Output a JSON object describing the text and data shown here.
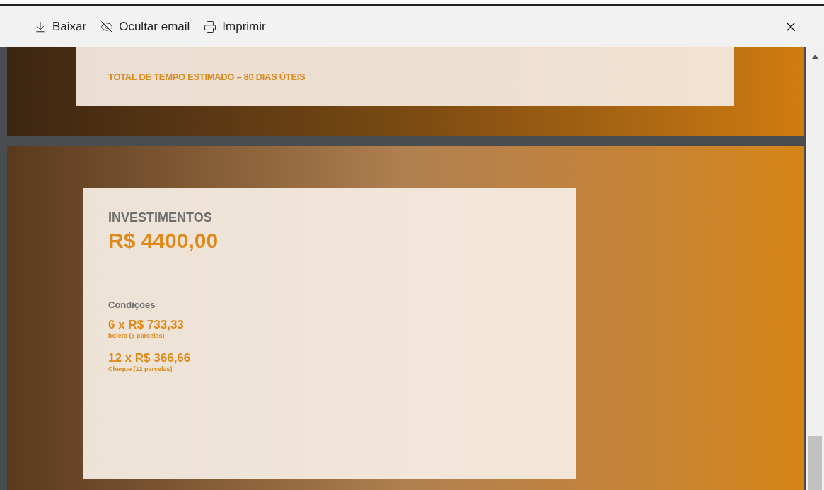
{
  "toolbar": {
    "actions": [
      {
        "kind": "download",
        "label": "Baixar"
      },
      {
        "kind": "hide",
        "label": "Ocultar email"
      },
      {
        "kind": "print",
        "label": "Imprimir"
      }
    ]
  },
  "slides": [
    {
      "kind": "timeline",
      "total": "TOTAL DE TEMPO ESTIMADO – 80 DIAS ÚTEIS"
    },
    {
      "kind": "investment",
      "heading": "INVESTIMENTOS",
      "price": "R$ 4400,00",
      "conditions_label": "Condições",
      "options": [
        {
          "amount": "6 x R$ 733,33",
          "note": "boleto (6 parcelas)"
        },
        {
          "amount": "12 x R$ 366,66",
          "note": "Cheque (12 parcelas)"
        }
      ]
    }
  ]
}
